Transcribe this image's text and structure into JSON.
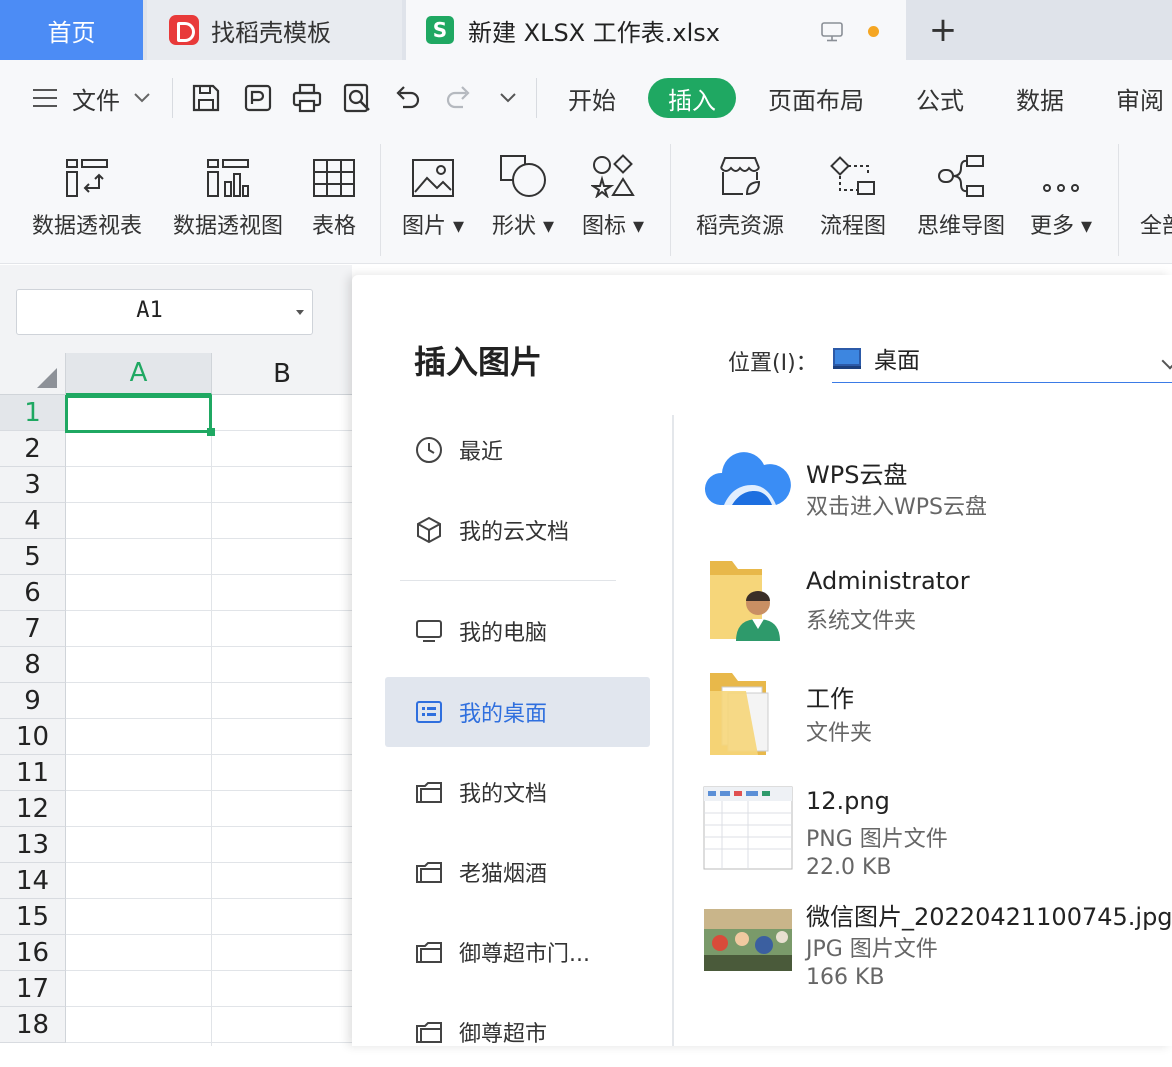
{
  "tabs": {
    "home": "首页",
    "template": "找稻壳模板",
    "document": "新建 XLSX 工作表.xlsx",
    "plus": "+"
  },
  "menubar": {
    "file": "文件",
    "items": [
      "开始",
      "插入",
      "页面布局",
      "公式",
      "数据",
      "审阅"
    ],
    "active": "插入"
  },
  "ribbon": {
    "buttons": [
      "数据透视表",
      "数据透视图",
      "表格",
      "图片",
      "形状",
      "图标",
      "稻壳资源",
      "流程图",
      "思维导图",
      "更多",
      "全部"
    ]
  },
  "sheet": {
    "name_box": "A1",
    "columns": [
      "A",
      "B"
    ],
    "rows": [
      "1",
      "2",
      "3",
      "4",
      "5",
      "6",
      "7",
      "8",
      "9",
      "10",
      "11",
      "12",
      "13",
      "14",
      "15",
      "16",
      "17",
      "18"
    ]
  },
  "dialog": {
    "title": "插入图片",
    "location_label": "位置(I)：",
    "location_value": "桌面",
    "nav": [
      "最近",
      "我的云文档",
      "我的电脑",
      "我的桌面",
      "我的文档",
      "老猫烟酒",
      "御尊超市门...",
      "御尊超市"
    ],
    "active_nav": "我的桌面",
    "files": [
      {
        "name": "WPS云盘",
        "sub1": "双击进入WPS云盘"
      },
      {
        "name": "Administrator",
        "sub1": "系统文件夹"
      },
      {
        "name": "工作",
        "sub1": "文件夹"
      },
      {
        "name": "12.png",
        "sub1": "PNG 图片文件",
        "sub2": "22.0 KB"
      },
      {
        "name": "微信图片_20220421100745.jpg",
        "sub1": "JPG 图片文件",
        "sub2": "166 KB"
      }
    ]
  },
  "colors": {
    "accent_green": "#1fa862",
    "home_tab_blue": "#4c8cf5",
    "active_nav_text": "#2f6fde"
  }
}
